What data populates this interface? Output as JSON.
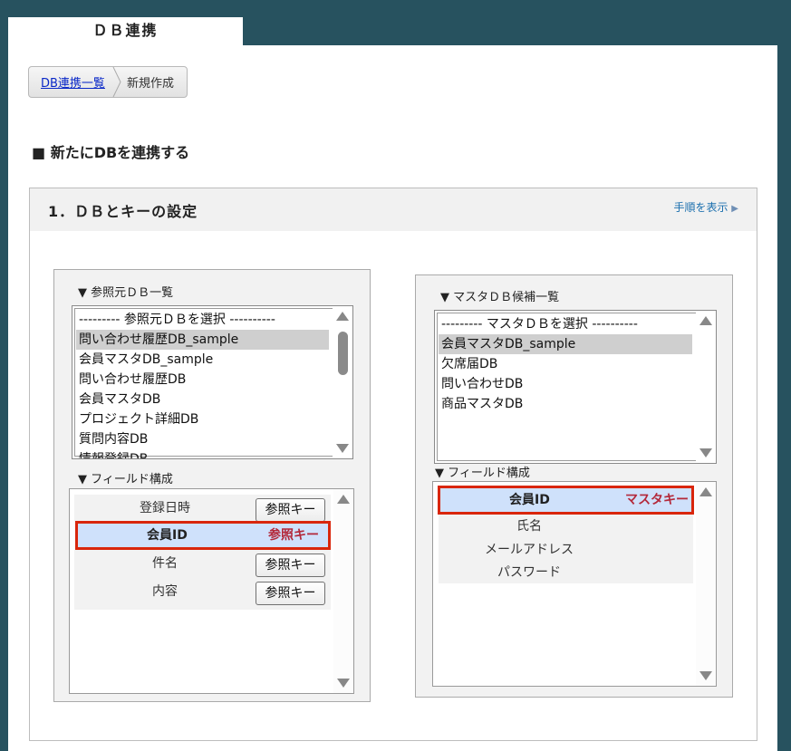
{
  "tab": {
    "title": "ＤＢ連携"
  },
  "breadcrumb": {
    "link": "DB連携一覧",
    "current": "新規作成"
  },
  "section": {
    "title": "■ 新たにDBを連携する"
  },
  "step": {
    "title": "1．ＤＢとキーの設定",
    "help_link": "手順を表示"
  },
  "source": {
    "list_label": "▼ 参照元ＤＢ一覧",
    "items": [
      "--------- 参照元ＤＢを選択 ----------",
      "問い合わせ履歴DB_sample",
      "会員マスタDB_sample",
      "問い合わせ履歴DB",
      "会員マスタDB",
      "プロジェクト詳細DB",
      "質問内容DB",
      "情報登録DB"
    ],
    "selected_index": 1,
    "fields_label": "▼ フィールド構成",
    "fields": [
      {
        "name": "登録日時",
        "button": "参照キー"
      },
      {
        "name": "会員ID",
        "key": "参照キー"
      },
      {
        "name": "件名",
        "button": "参照キー"
      },
      {
        "name": "内容",
        "button": "参照キー"
      }
    ]
  },
  "master": {
    "list_label": "▼ マスタＤＢ候補一覧",
    "items": [
      "--------- マスタＤＢを選択 ----------",
      "会員マスタDB_sample",
      "欠席届DB",
      "問い合わせDB",
      "商品マスタDB"
    ],
    "selected_index": 1,
    "fields_label": "▼ フィールド構成",
    "fields": [
      {
        "name": "会員ID",
        "key": "マスタキー"
      },
      {
        "name": "氏名"
      },
      {
        "name": "メールアドレス"
      },
      {
        "name": "パスワード"
      }
    ]
  },
  "colors": {
    "background": "#27525f",
    "highlight_border": "#d9260c",
    "key_text": "#b3283a",
    "selected_bg": "#cfe1fb"
  }
}
